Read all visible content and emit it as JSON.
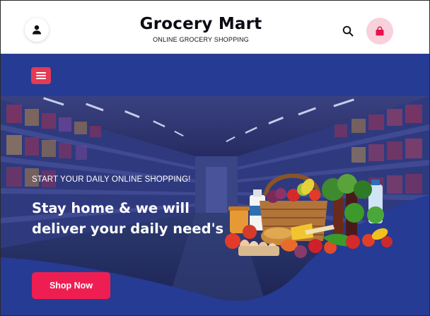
{
  "header": {
    "brand_title": "Grocery Mart",
    "brand_subtitle": "ONLINE GROCERY SHOPPING",
    "icons": {
      "user": "user-icon",
      "search": "search-icon",
      "cart": "shopping-bag-icon"
    }
  },
  "nav": {
    "menu_icon": "hamburger-menu-icon"
  },
  "hero": {
    "kicker": "START YOUR DAILY ONLINE SHOPPING!",
    "headline_line1": "Stay home & we will",
    "headline_line2": "deliver your daily need's",
    "cta_label": "Shop Now",
    "image": "supermarket-aisle-and-grocery-basket"
  },
  "colors": {
    "accent": "#ee1e52",
    "nav_blue": "#263b93",
    "menu_button": "#e53a54",
    "cart_bg": "#f8d1dc"
  }
}
